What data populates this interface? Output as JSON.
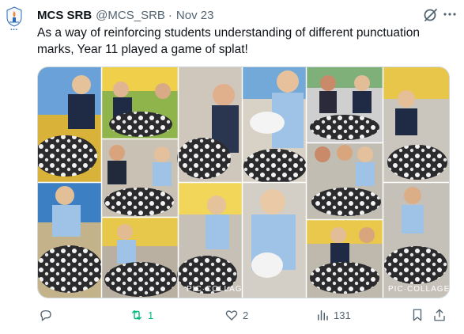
{
  "tweet": {
    "author_name": "MCS SRB",
    "handle": "@MCS_SRB",
    "separator": "·",
    "date": "Nov 23",
    "text": "As a way of reinforcing students understanding of different punctuation marks, Year 11 played a game of splat!",
    "media": {
      "watermarks": [
        "PIC·COLLAGE",
        "PIC·COLLAGE"
      ]
    }
  },
  "actions": {
    "retweets": "1",
    "likes": "2",
    "views": "131"
  },
  "colors": {
    "retweet_active": "#00ba7c",
    "secondary_text": "#536471",
    "border": "#cfd9de"
  }
}
